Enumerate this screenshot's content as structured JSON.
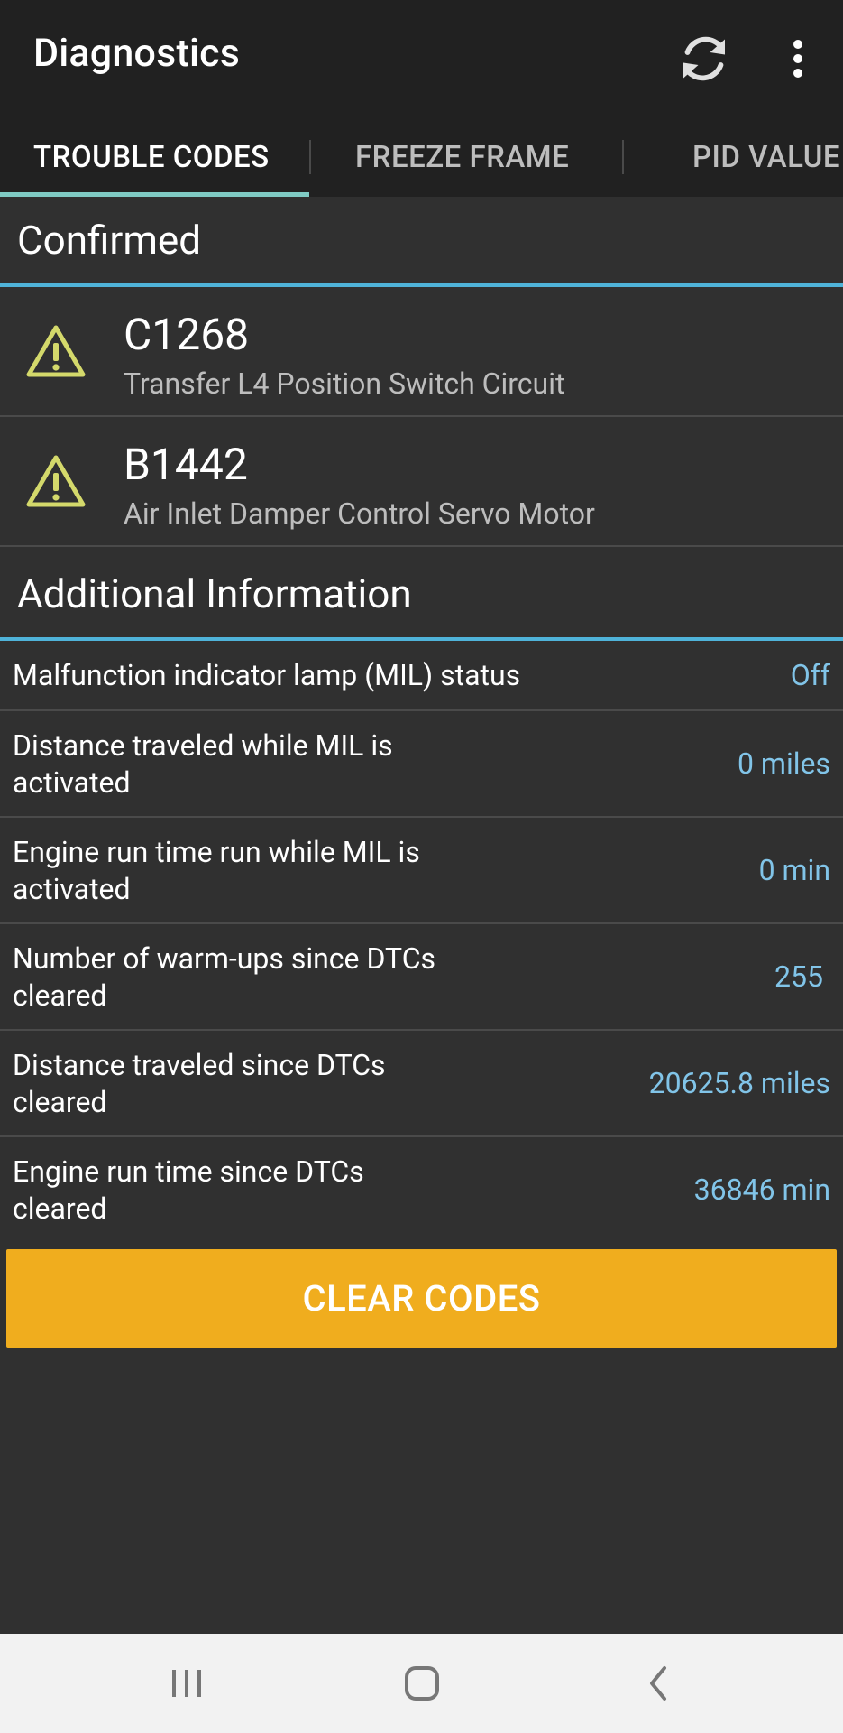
{
  "toolbar": {
    "title": "Diagnostics",
    "refresh_icon": "refresh-icon",
    "more_icon": "more-vert-icon"
  },
  "tabs": [
    {
      "label": "TROUBLE CODES",
      "selected": true
    },
    {
      "label": "FREEZE FRAME",
      "selected": false
    },
    {
      "label": "PID VALUE",
      "selected": false
    }
  ],
  "confirmed": {
    "header": "Confirmed",
    "codes": [
      {
        "code": "C1268",
        "description": "Transfer L4 Position Switch Circuit",
        "icon": "warning-icon"
      },
      {
        "code": "B1442",
        "description": "Air Inlet Damper Control Servo Motor",
        "icon": "warning-icon"
      }
    ]
  },
  "additional": {
    "header": "Additional Information",
    "rows": [
      {
        "label": "Malfunction indicator lamp (MIL) status",
        "value": "Off"
      },
      {
        "label": "Distance traveled while MIL is activated",
        "value": "0 miles"
      },
      {
        "label": "Engine run time run while MIL is activated",
        "value": "0 min"
      },
      {
        "label": "Number of warm-ups since DTCs cleared",
        "value": "255"
      },
      {
        "label": "Distance traveled since DTCs cleared",
        "value": "20625.8 miles"
      },
      {
        "label": "Engine run time since DTCs cleared",
        "value": "36846 min"
      }
    ]
  },
  "clear_button": {
    "label": "CLEAR CODES"
  },
  "colors": {
    "accent_line": "#4fb3d9",
    "tab_indicator": "#80cbc4",
    "value_text": "#81c4e8",
    "warning": "#d4d96b",
    "button": "#f0ad1e"
  },
  "navbar": {
    "recents_icon": "recents-icon",
    "home_icon": "home-icon",
    "back_icon": "back-icon"
  }
}
